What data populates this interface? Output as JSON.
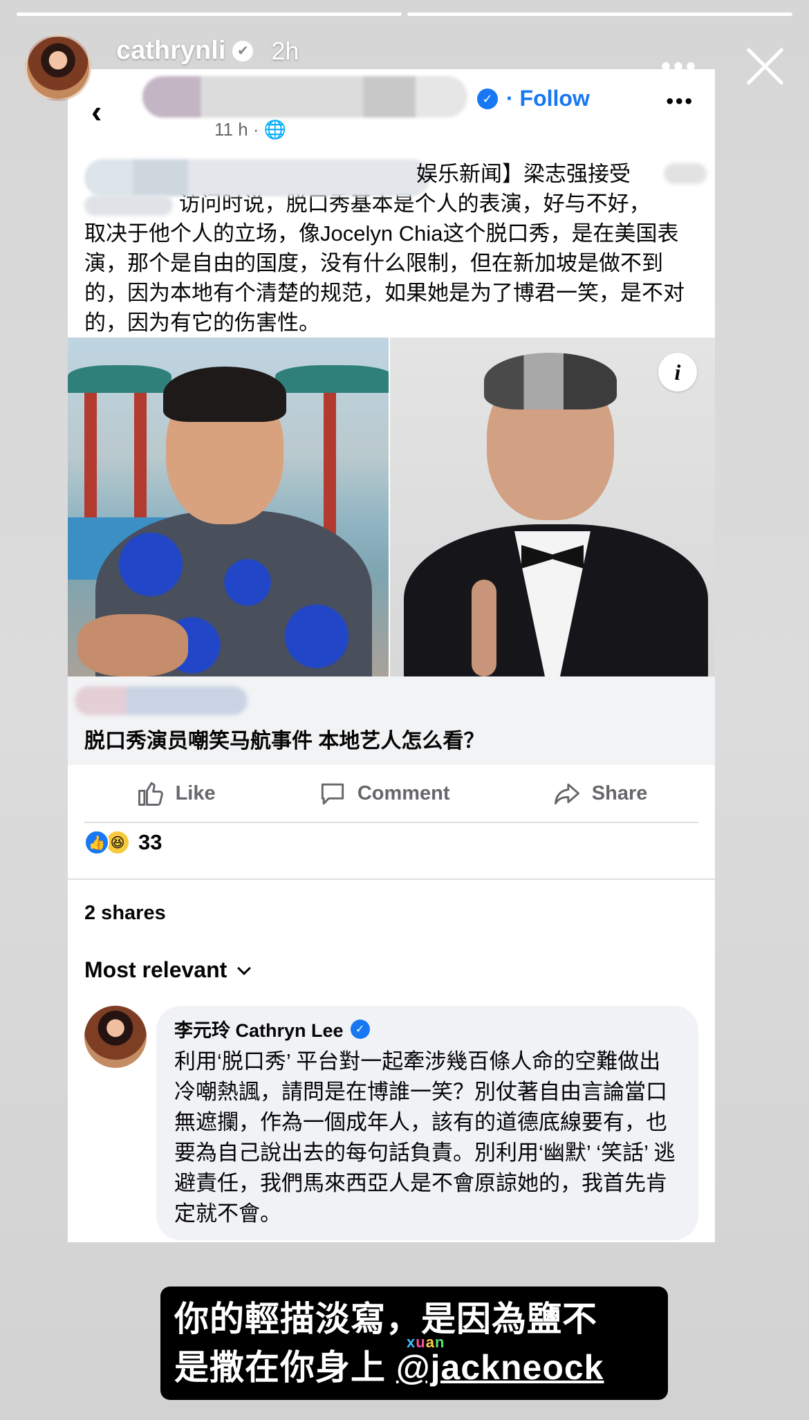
{
  "story": {
    "progress_segments": 2,
    "progress_done": 2,
    "username": "cathrynli",
    "verified_glyph": "✔",
    "time_ago": "2h",
    "more_icon": "more-horizontal-icon",
    "more_glyph": "•••"
  },
  "facebook_post": {
    "back_glyph": "‹",
    "verified_glyph": "✓",
    "follow_label": "· Follow",
    "more_glyph": "•••",
    "timestamp": "11 h · 🌐",
    "text_line1_visible": "娱乐新闻】梁志强接受",
    "text_line2_visible": "访问时说，脱口秀基本是个人的表演，好与不好，",
    "text_rest": "取决于他个人的立场，像Jocelyn Chia这个脱口秀，是在美国表演，那个是自由的国度，没有什么限制，但在新加坡是做不到的，因为本地有个清楚的规范，如果她是为了博君一笑，是不对的，因为有它的伤害性。",
    "info_glyph": "i",
    "link_title": "脱口秀演员嘲笑马航事件 本地艺人怎么看？",
    "actions": {
      "like": "Like",
      "comment": "Comment",
      "share": "Share"
    },
    "reaction_count": "33",
    "reaction_like_glyph": "👍",
    "reaction_haha_glyph": "😆",
    "shares_label": "2 shares",
    "sort_label": "Most relevant",
    "comment": {
      "author": "李元玲 Cathryn Lee",
      "verified_glyph": "✓",
      "text": "利用‘脱口秀’ 平台對一起牽涉幾百條人命的空難做出冷嘲熱諷，請問是在博誰一笑？別仗著自由言論當口無遮攔，作為一個成年人，該有的道德底線要有，也要為自己說出去的每句話負責。別利用‘幽默’ ‘笑話’ 逃避責任，我們馬來西亞人是不會原諒她的，我首先肯定就不會。"
    }
  },
  "caption": {
    "line1": "你的輕描淡寫，是因為鹽不",
    "line2_prefix": "是撒在你身上 ",
    "mention": "@jackneock"
  },
  "watermark": {
    "c1": "x",
    "c2": "u",
    "c3": "a",
    "c4": "n"
  },
  "colors": {
    "facebook_blue": "#1877f2",
    "secondary_text": "#65676b",
    "bubble_bg": "#f0f2f5"
  }
}
